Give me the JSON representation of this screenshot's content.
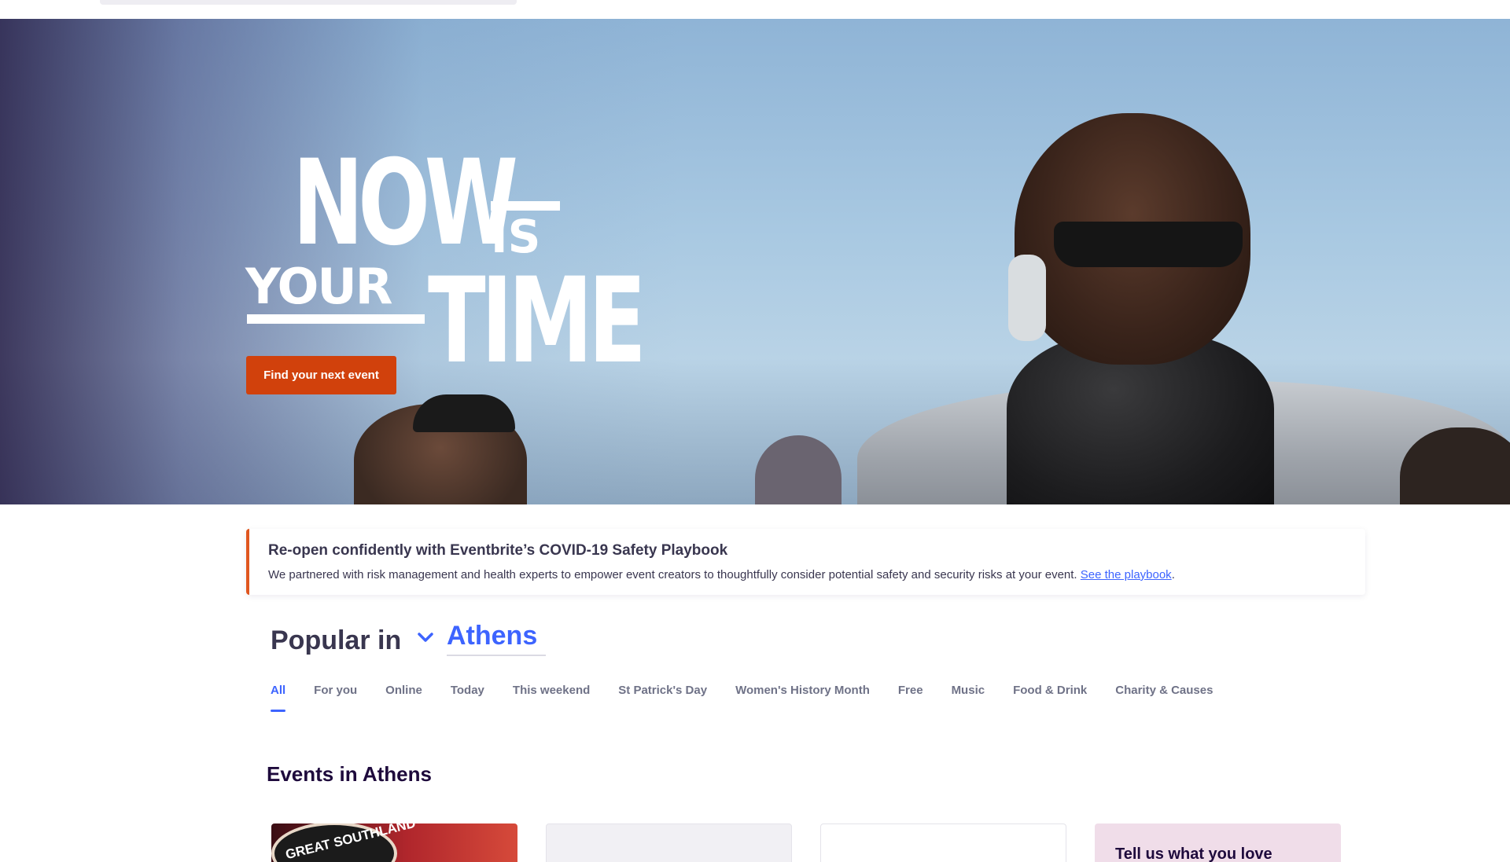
{
  "hero": {
    "title_now": "NOW",
    "title_is": "IS",
    "title_your": "YOUR",
    "title_time": "TIME",
    "cta_label": "Find your next event"
  },
  "banner": {
    "title": "Re-open confidently with Eventbrite’s COVID-19 Safety Playbook",
    "text": "We partnered with risk management and health experts to empower event creators to thoughtfully consider potential safety and security risks at your event.",
    "link_label": "See the playbook",
    "trailing": "."
  },
  "popular": {
    "label": "Popular in",
    "location": "Athens"
  },
  "tabs": [
    {
      "label": "All",
      "active": true
    },
    {
      "label": "For you"
    },
    {
      "label": "Online"
    },
    {
      "label": "Today"
    },
    {
      "label": "This weekend"
    },
    {
      "label": "St Patrick's Day"
    },
    {
      "label": "Women's History Month"
    },
    {
      "label": "Free"
    },
    {
      "label": "Music"
    },
    {
      "label": "Food & Drink"
    },
    {
      "label": "Charity & Causes"
    }
  ],
  "events": {
    "section_title": "Events in Athens",
    "card1_badge": "GREAT SOUTHLAND",
    "promo_title": "Tell us what you love"
  },
  "colors": {
    "accent": "#3d64ff",
    "cta": "#d1410c",
    "banner_border": "#e0561f",
    "heading": "#1e0a3c",
    "promo_bg": "#f0dde9"
  }
}
